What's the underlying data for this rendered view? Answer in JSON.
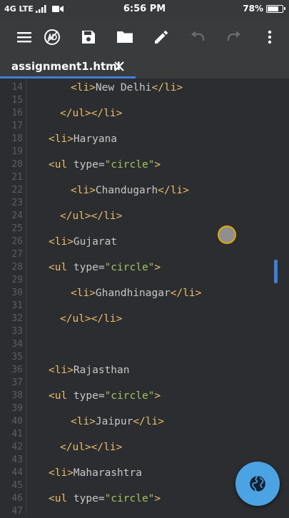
{
  "status_bar": {
    "network": "4G LTE",
    "time": "6:56 PM",
    "battery": "78%",
    "battery_level": 0.78
  },
  "toolbar": {
    "icons": [
      "menu-icon",
      "ad-icon",
      "save-icon",
      "folder-icon",
      "edit-icon",
      "undo-icon",
      "redo-icon",
      "more-vert-icon"
    ]
  },
  "tab": {
    "label": "assignment1.html"
  },
  "editor": {
    "lines": [
      {
        "n": "14",
        "indent": 2,
        "parts": [
          [
            "tag",
            "<li>"
          ],
          [
            "txt",
            "New Delhi"
          ],
          [
            "tag",
            "</li>"
          ]
        ]
      },
      {
        "n": "15",
        "indent": 0,
        "parts": []
      },
      {
        "n": "16",
        "indent": 1,
        "parts": [
          [
            "tag",
            "</ul></li>"
          ]
        ]
      },
      {
        "n": "17",
        "indent": 0,
        "parts": []
      },
      {
        "n": "18",
        "indent": 0,
        "parts": [
          [
            "tag",
            "<li>"
          ],
          [
            "txt",
            "Haryana"
          ]
        ]
      },
      {
        "n": "19",
        "indent": 0,
        "parts": []
      },
      {
        "n": "20",
        "indent": 0,
        "parts": [
          [
            "tag",
            "<ul "
          ],
          [
            "txt",
            "type="
          ],
          [
            "str",
            "\"circle\""
          ],
          [
            "tag",
            ">"
          ]
        ]
      },
      {
        "n": "21",
        "indent": 0,
        "parts": []
      },
      {
        "n": "22",
        "indent": 2,
        "parts": [
          [
            "tag",
            "<li>"
          ],
          [
            "txt",
            "Chandugarh"
          ],
          [
            "tag",
            "</li>"
          ]
        ]
      },
      {
        "n": "23",
        "indent": 0,
        "parts": []
      },
      {
        "n": "24",
        "indent": 1,
        "parts": [
          [
            "tag",
            "</ul></li>"
          ]
        ]
      },
      {
        "n": "25",
        "indent": 0,
        "parts": []
      },
      {
        "n": "26",
        "indent": 0,
        "parts": [
          [
            "tag",
            "<li>"
          ],
          [
            "txt",
            "Gujarat"
          ]
        ]
      },
      {
        "n": "27",
        "indent": 0,
        "parts": []
      },
      {
        "n": "28",
        "indent": 0,
        "parts": [
          [
            "tag",
            "<ul "
          ],
          [
            "txt",
            "type="
          ],
          [
            "str",
            "\"circle\""
          ],
          [
            "tag",
            ">"
          ]
        ]
      },
      {
        "n": "29",
        "indent": 0,
        "parts": []
      },
      {
        "n": "30",
        "indent": 2,
        "parts": [
          [
            "tag",
            "<li>"
          ],
          [
            "txt",
            "Ghandhinagar"
          ],
          [
            "tag",
            "</li>"
          ]
        ]
      },
      {
        "n": "31",
        "indent": 0,
        "parts": []
      },
      {
        "n": "32",
        "indent": 1,
        "parts": [
          [
            "tag",
            "</ul></li>"
          ]
        ]
      },
      {
        "n": "33",
        "indent": 0,
        "parts": []
      },
      {
        "n": "34",
        "indent": 0,
        "parts": []
      },
      {
        "n": "35",
        "indent": 0,
        "parts": []
      },
      {
        "n": "36",
        "indent": 0,
        "parts": [
          [
            "tag",
            "<li>"
          ],
          [
            "txt",
            "Rajasthan"
          ]
        ]
      },
      {
        "n": "37",
        "indent": 0,
        "parts": []
      },
      {
        "n": "38",
        "indent": 0,
        "parts": [
          [
            "tag",
            "<ul "
          ],
          [
            "txt",
            "type="
          ],
          [
            "str",
            "\"circle\""
          ],
          [
            "tag",
            ">"
          ]
        ]
      },
      {
        "n": "39",
        "indent": 0,
        "parts": []
      },
      {
        "n": "40",
        "indent": 2,
        "parts": [
          [
            "tag",
            "<li>"
          ],
          [
            "txt",
            "Jaipur"
          ],
          [
            "tag",
            "</li>"
          ]
        ]
      },
      {
        "n": "41",
        "indent": 0,
        "parts": []
      },
      {
        "n": "42",
        "indent": 1,
        "parts": [
          [
            "tag",
            "</ul></li>"
          ]
        ]
      },
      {
        "n": "43",
        "indent": 0,
        "parts": []
      },
      {
        "n": "44",
        "indent": 0,
        "parts": [
          [
            "tag",
            "<li>"
          ],
          [
            "txt",
            "Maharashtra"
          ]
        ]
      },
      {
        "n": "45",
        "indent": 0,
        "parts": []
      },
      {
        "n": "46",
        "indent": 0,
        "parts": [
          [
            "tag",
            "<ul "
          ],
          [
            "txt",
            "type="
          ],
          [
            "str",
            "\"circle\""
          ],
          [
            "tag",
            ">"
          ]
        ]
      },
      {
        "n": "47",
        "indent": 0,
        "parts": []
      }
    ]
  },
  "fab": {
    "icon": "globe-icon"
  },
  "colors": {
    "accent": "#3f7fd6",
    "tag": "#e8bf6a",
    "string": "#a5c25c",
    "text": "#c8c8c8",
    "fab": "#4ba3e3"
  }
}
